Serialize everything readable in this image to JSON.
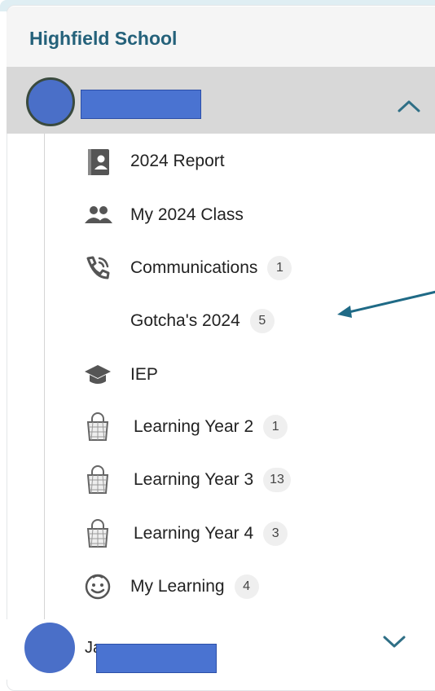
{
  "school": {
    "name": "Highfield School"
  },
  "user": {
    "name_redacted": true
  },
  "nav": {
    "items": [
      {
        "label": "2024 Report",
        "icon": "report-book-icon",
        "badge": null
      },
      {
        "label": "My 2024 Class",
        "icon": "people-icon",
        "badge": null
      },
      {
        "label": "Communications",
        "icon": "phone-icon",
        "badge": "1"
      },
      {
        "label": "Gotcha's 2024",
        "icon": "",
        "badge": "5"
      },
      {
        "label": "IEP",
        "icon": "graduation-cap-icon",
        "badge": null
      },
      {
        "label": "Learning Year 2",
        "icon": "lock-basket-icon",
        "badge": "1"
      },
      {
        "label": "Learning Year 3",
        "icon": "lock-basket-icon",
        "badge": "13"
      },
      {
        "label": "Learning Year 4",
        "icon": "lock-basket-icon",
        "badge": "3"
      },
      {
        "label": "My Learning",
        "icon": "smiley-icon",
        "badge": "4"
      }
    ]
  },
  "second_user": {
    "name_visible": "Ja"
  },
  "colors": {
    "brand": "#24617a",
    "arrow": "#1f6a86",
    "redact": "#4a73d1"
  }
}
